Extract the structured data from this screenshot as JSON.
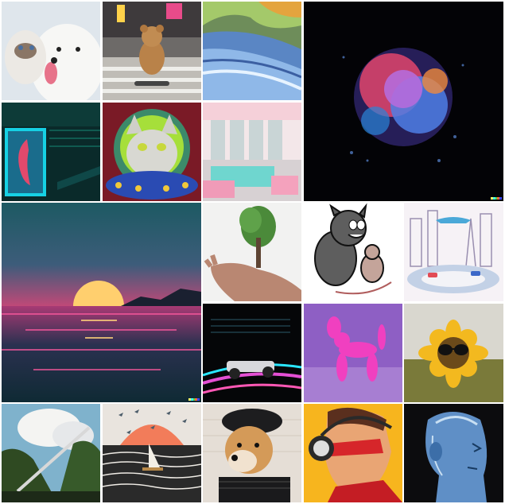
{
  "gallery": {
    "tiles": [
      {
        "id": "cat-and-dog",
        "icon": "cat-dog-image"
      },
      {
        "id": "teddy-skateboard",
        "icon": "teddy-bear-image"
      },
      {
        "id": "impressionist-river",
        "icon": "painting-image"
      },
      {
        "id": "powder-explosion",
        "icon": "explosion-image"
      },
      {
        "id": "neon-face-poster",
        "icon": "neon-image"
      },
      {
        "id": "cat-in-ufo",
        "icon": "cat-painting-image"
      },
      {
        "id": "pink-pool-room",
        "icon": "interior-image"
      },
      {
        "id": "synthwave-sunset",
        "icon": "sunset-image"
      },
      {
        "id": "tree-in-hand",
        "icon": "tree-image"
      },
      {
        "id": "cartoon-cat-mouse",
        "icon": "cartoon-image"
      },
      {
        "id": "futuristic-city",
        "icon": "city-image"
      },
      {
        "id": "neon-race-car",
        "icon": "race-car-image"
      },
      {
        "id": "balloon-dog",
        "icon": "balloon-dog-image"
      },
      {
        "id": "sunflower-sunglasses",
        "icon": "sunflower-image"
      },
      {
        "id": "cloud-waterfall",
        "icon": "landscape-image"
      },
      {
        "id": "sailboat-sunset",
        "icon": "sailboat-image"
      },
      {
        "id": "shiba-beret",
        "icon": "dog-portrait-image"
      },
      {
        "id": "comic-hero-headphones",
        "icon": "comic-image"
      },
      {
        "id": "blue-cyborg-head",
        "icon": "cyborg-image"
      }
    ],
    "watermark_colors": [
      "#ffff66",
      "#42ffff",
      "#51da4c",
      "#ff6e3c",
      "#3c46ff"
    ]
  }
}
